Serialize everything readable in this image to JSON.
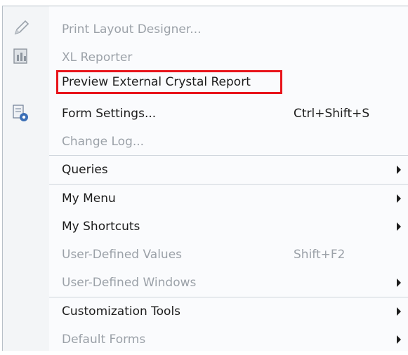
{
  "menu": {
    "items": [
      {
        "label": "Print Layout Designer...",
        "shortcut": "",
        "submenu": false,
        "disabled": true,
        "icon": "pencil-icon"
      },
      {
        "label": "XL Reporter",
        "shortcut": "",
        "submenu": false,
        "disabled": true,
        "icon": "xl-reporter-icon"
      },
      {
        "label": "Preview External Crystal Report",
        "shortcut": "",
        "submenu": false,
        "disabled": false,
        "highlighted": true
      },
      {
        "label": "Form Settings...",
        "shortcut": "Ctrl+Shift+S",
        "submenu": false,
        "disabled": false,
        "icon": "form-settings-icon"
      },
      {
        "label": "Change Log...",
        "shortcut": "",
        "submenu": false,
        "disabled": true
      },
      {
        "label": "Queries",
        "shortcut": "",
        "submenu": true,
        "disabled": false
      },
      {
        "label": "My Menu",
        "shortcut": "",
        "submenu": true,
        "disabled": false
      },
      {
        "label": "My Shortcuts",
        "shortcut": "",
        "submenu": true,
        "disabled": false
      },
      {
        "label": "User-Defined Values",
        "shortcut": "Shift+F2",
        "submenu": false,
        "disabled": true
      },
      {
        "label": "User-Defined Windows",
        "shortcut": "",
        "submenu": true,
        "disabled": true
      },
      {
        "label": "Customization Tools",
        "shortcut": "",
        "submenu": true,
        "disabled": false
      },
      {
        "label": "Default Forms",
        "shortcut": "",
        "submenu": true,
        "disabled": true
      }
    ],
    "highlight_color": "#e8141b"
  }
}
